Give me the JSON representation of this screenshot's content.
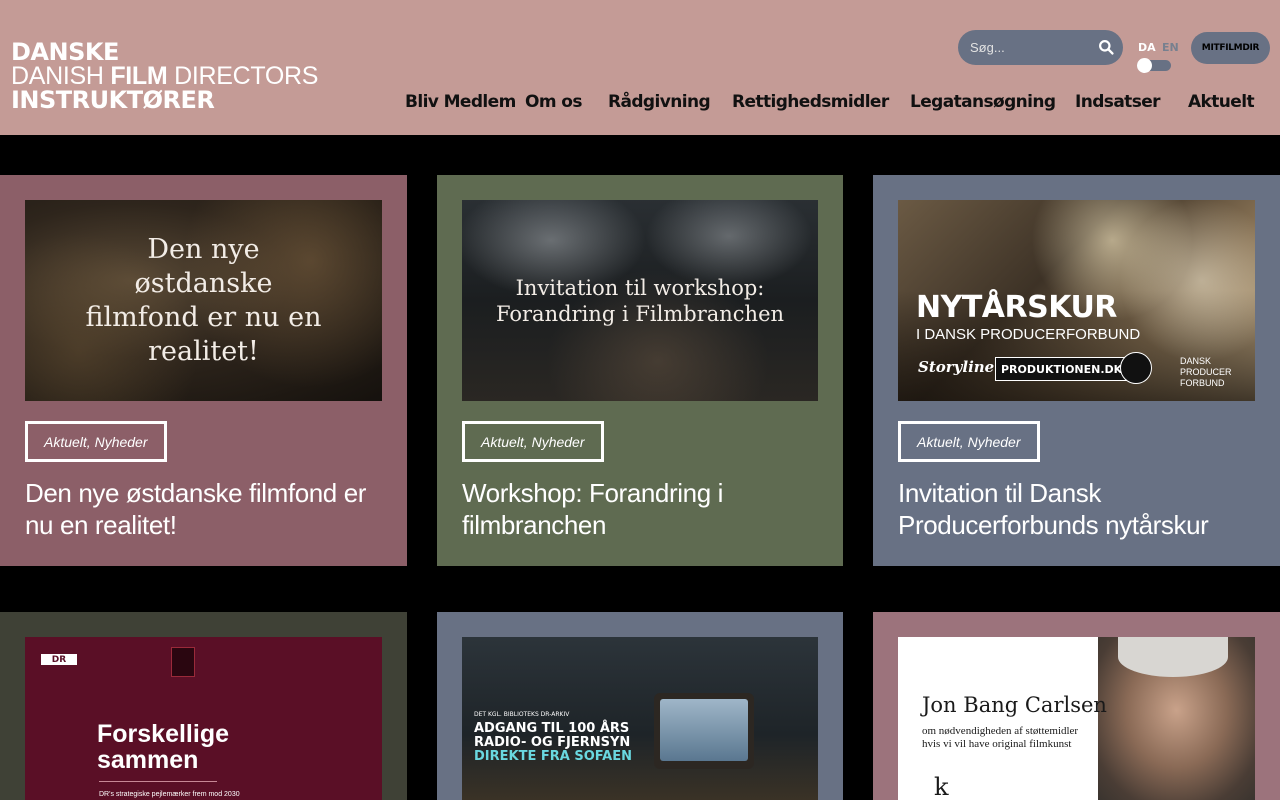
{
  "header": {
    "logo": {
      "line1": "DANSKE",
      "line2_pre": "DANISH ",
      "line2_bold": "FILM",
      "line2_post": " DIRECTORS",
      "line3": "INSTRUKTØRER"
    },
    "search": {
      "placeholder": "Søg..."
    },
    "lang": {
      "da": "DA",
      "en": "EN"
    },
    "mitfilm_label": "MITFILMDIR"
  },
  "nav": [
    {
      "label": "Bliv Medlem"
    },
    {
      "label": "Om os"
    },
    {
      "label": "Rådgivning"
    },
    {
      "label": "Rettighedsmidler"
    },
    {
      "label": "Legatansøgning"
    },
    {
      "label": "Indsatser"
    },
    {
      "label": "Aktuelt"
    }
  ],
  "cards": [
    {
      "tag": "Aktuelt, Nyheder",
      "title": "Den nye østdanske filmfond er nu en realitet!",
      "image_text": "Den nye østdanske filmfond er nu en realitet!",
      "bg": "#8c5f68"
    },
    {
      "tag": "Aktuelt, Nyheder",
      "title": "Workshop: Forandring i filmbranchen",
      "image_text_1": "Invitation til workshop:",
      "image_text_2": "Forandring i Filmbranchen",
      "bg": "#5f6b51"
    },
    {
      "tag": "Aktuelt, Nyheder",
      "title": "Invitation til Dansk Producerforbunds nytårskur",
      "image_title": "NYTÅRSKUR",
      "image_sub": "I DANSK PRODUCERFORBUND",
      "logo_storyline": "Storyline",
      "logo_produktionen": "PRODUKTIONEN.DK",
      "logo_dansk_1": "DANSK",
      "logo_dansk_2": "PRODUCER",
      "logo_dansk_3": "FORBUND",
      "bg": "#687184"
    },
    {
      "image_dr": "DR",
      "image_title_1": "Forskellige",
      "image_title_2": "sammen",
      "image_sub": "DR's strategiske pejlemærker frem mod 2030",
      "bg": "#3f4136"
    },
    {
      "image_line1": "DET KGL. BIBLIOTEKS DR-ARKIV",
      "image_line2": "ADGANG TIL 100 ÅRS",
      "image_line3": "RADIO- OG FJERNSYN",
      "image_line4": "DIREKTE FRA SOFAEN",
      "bg": "#687184"
    },
    {
      "image_name": "Jon Bang Carlsen",
      "image_sub_1": "om nødvendigheden af støttemidler",
      "image_sub_2": "hvis vi vil have original filmkunst",
      "bg": "#9c737c"
    }
  ]
}
